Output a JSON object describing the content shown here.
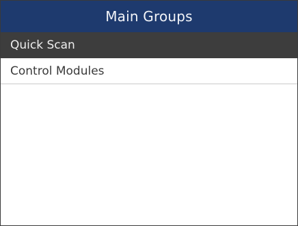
{
  "header": {
    "title": "Main Groups"
  },
  "menu": {
    "items": [
      {
        "label": "Quick Scan",
        "selected": true
      },
      {
        "label": "Control Modules",
        "selected": false
      }
    ]
  },
  "colors": {
    "header_background": "#1e3a6e",
    "selected_background": "#3d3d3d",
    "text": "#3a3a3a"
  }
}
